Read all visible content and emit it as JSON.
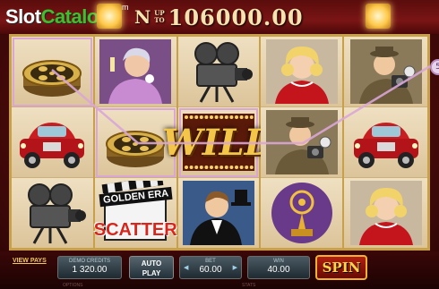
{
  "brand": {
    "logo_slot": "Slot",
    "logo_catalog": "Catalog",
    "logo_com": ".com"
  },
  "jackpot": {
    "prefix": "N",
    "up": "UP",
    "to": "TO",
    "amount": "106000.00"
  },
  "reels": [
    [
      {
        "symbol": "film-reel",
        "highlight": true
      },
      {
        "symbol": "vintage-car"
      },
      {
        "symbol": "movie-camera"
      }
    ],
    [
      {
        "symbol": "diva-lady"
      },
      {
        "symbol": "film-reel",
        "highlight": true
      },
      {
        "symbol": "scatter-clapperboard"
      }
    ],
    [
      {
        "symbol": "movie-camera"
      },
      {
        "symbol": "wild",
        "highlight": true
      },
      {
        "symbol": "actor-tuxedo"
      }
    ],
    [
      {
        "symbol": "blonde-starlet"
      },
      {
        "symbol": "photographer"
      },
      {
        "symbol": "golden-award"
      }
    ],
    [
      {
        "symbol": "photographer"
      },
      {
        "symbol": "vintage-car"
      },
      {
        "symbol": "blonde-starlet"
      }
    ]
  ],
  "symbols": {
    "wild_text": "WILD",
    "scatter_top": "GOLDEN ERA",
    "scatter_word": "SCATTER"
  },
  "winline": {
    "badge": "5",
    "color": "#d9a6d6"
  },
  "controls": {
    "view_pays": "VIEW PAYS",
    "credits_label": "DEMO CREDITS",
    "credits_value": "1 320.00",
    "autoplay_line1": "AUTO",
    "autoplay_line2": "PLAY",
    "bet_label": "BET",
    "bet_value": "60.00",
    "win_label": "WIN",
    "win_value": "40.00",
    "spin": "SPIN",
    "options": "OPTIONS",
    "stats": "STATS"
  },
  "colors": {
    "accent": "#f0b230",
    "reel_bg": "#e9d7b4",
    "frame": "#c9a04a"
  }
}
